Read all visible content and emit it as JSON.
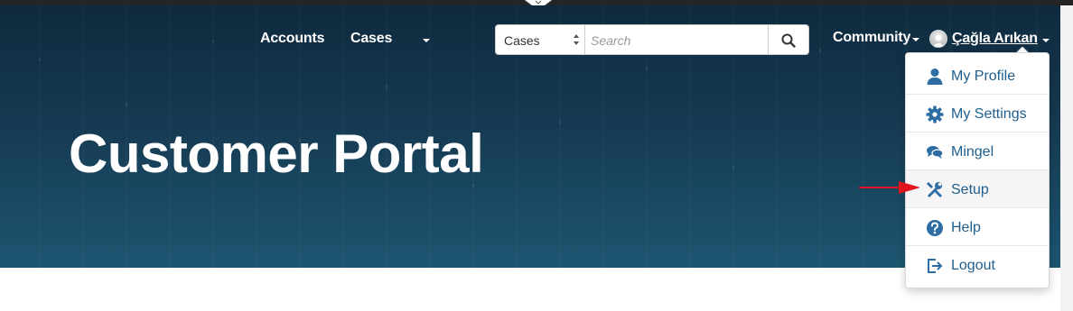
{
  "nav": {
    "accounts_label": "Accounts",
    "cases_label": "Cases",
    "community_label": "Community",
    "user_name": "Çağla Arıkan"
  },
  "search": {
    "scope_value": "Cases",
    "placeholder": "Search"
  },
  "hero": {
    "title": "Customer Portal"
  },
  "user_menu": {
    "items": [
      {
        "label": "My Profile",
        "icon": "user-icon"
      },
      {
        "label": "My Settings",
        "icon": "gear-icon"
      },
      {
        "label": "Mingel",
        "icon": "chat-bubbles-icon"
      },
      {
        "label": "Setup",
        "icon": "tools-icon"
      },
      {
        "label": "Help",
        "icon": "help-icon"
      },
      {
        "label": "Logout",
        "icon": "logout-icon"
      }
    ]
  },
  "colors": {
    "hero_top": "#0f2a3d",
    "hero_bottom": "#1c5570",
    "menu_link": "#1f5e8c",
    "annotation_arrow": "#e0141e"
  }
}
